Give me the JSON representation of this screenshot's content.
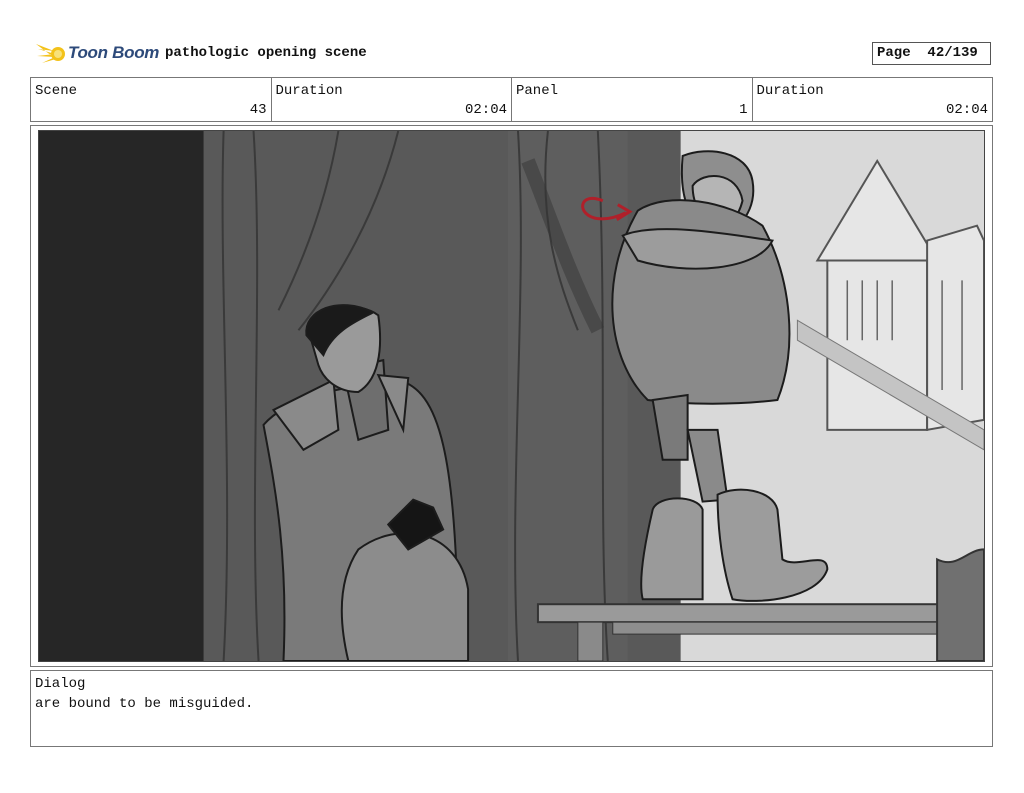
{
  "header": {
    "logo_text": "Toon Boom",
    "title": "pathologic opening scene",
    "page_label": "Page",
    "page_value": "42/139"
  },
  "meta": {
    "scene_label": "Scene",
    "scene_value": "43",
    "duration_label": "Duration",
    "duration_value": "02:04",
    "panel_label": "Panel",
    "panel_value": "1",
    "panel_duration_label": "Duration",
    "panel_duration_value": "02:04"
  },
  "dialog": {
    "label": "Dialog",
    "text": "are bound to be misguided."
  },
  "colors": {
    "logo_blue": "#2d4a7a",
    "logo_yellow": "#f3c21a",
    "annotation_red": "#b0202a"
  }
}
